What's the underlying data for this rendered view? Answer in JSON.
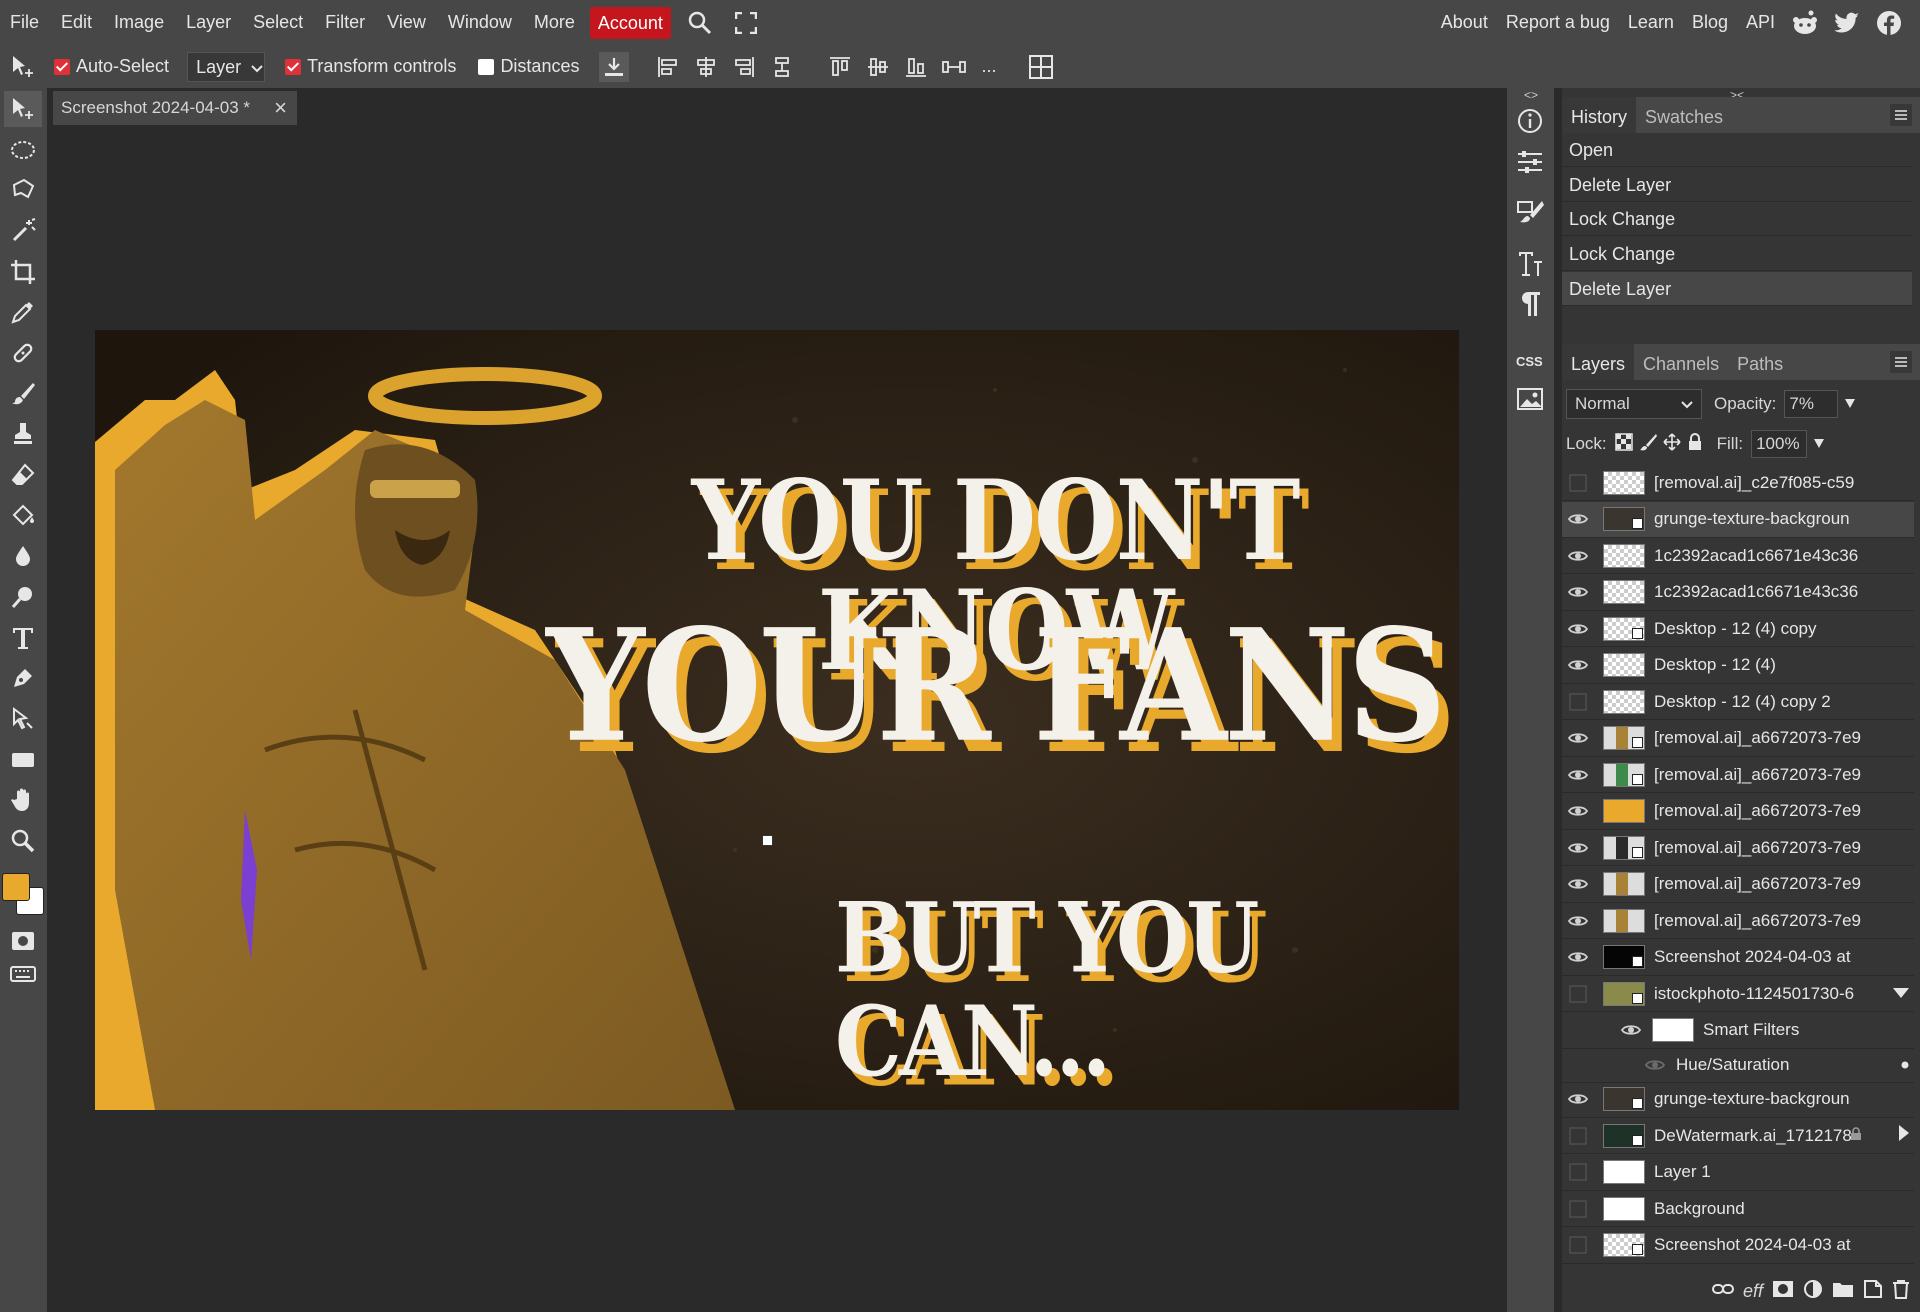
{
  "menu": {
    "items": [
      "File",
      "Edit",
      "Image",
      "Layer",
      "Select",
      "Filter",
      "View",
      "Window",
      "More"
    ],
    "account": "Account",
    "right_items": [
      "About",
      "Report a bug",
      "Learn",
      "Blog",
      "API"
    ]
  },
  "options": {
    "auto_select": "Auto-Select",
    "auto_select_checked": true,
    "layer_select": "Layer",
    "transform_controls": "Transform controls",
    "transform_checked": true,
    "distances": "Distances",
    "distances_checked": false,
    "more": "..."
  },
  "document": {
    "tab_title": "Screenshot 2024-04-03 *",
    "close": "×"
  },
  "artwork": {
    "line1": "YOU DON'T KNOW",
    "line2": "YOUR FANS",
    "line3": "BUT YOU CAN..."
  },
  "colors": {
    "foreground": "#e8a92c",
    "background": "#ffffff",
    "accent_red": "#c4161c",
    "panel": "#353535",
    "toolbar": "#474747"
  },
  "history": {
    "tabs": [
      "History",
      "Swatches"
    ],
    "active_tab": "History",
    "items": [
      "Open",
      "Delete Layer",
      "Lock Change",
      "Lock Change",
      "Delete Layer"
    ]
  },
  "layers": {
    "tabs": [
      "Layers",
      "Channels",
      "Paths"
    ],
    "active_tab": "Layers",
    "blend_mode": "Normal",
    "opacity_label": "Opacity:",
    "opacity_value": "7%",
    "lock_label": "Lock:",
    "fill_label": "Fill:",
    "fill_value": "100%",
    "rows": [
      {
        "name": "[removal.ai]_c2e7f085-c59",
        "visible": false,
        "thumb": "checker",
        "smart": false
      },
      {
        "name": "grunge-texture-backgroun",
        "visible": true,
        "thumb": "dark",
        "smart": true,
        "active": true
      },
      {
        "name": "1c2392acad1c6671e43c36",
        "visible": true,
        "thumb": "checker",
        "smart": false
      },
      {
        "name": "1c2392acad1c6671e43c36",
        "visible": true,
        "thumb": "checker",
        "smart": false
      },
      {
        "name": "Desktop - 12 (4) copy",
        "visible": true,
        "thumb": "checker",
        "smart": true
      },
      {
        "name": "Desktop - 12 (4)",
        "visible": true,
        "thumb": "checker",
        "smart": false
      },
      {
        "name": "Desktop - 12 (4) copy 2",
        "visible": false,
        "thumb": "checker",
        "smart": false
      },
      {
        "name": "[removal.ai]_a6672073-7e9",
        "visible": true,
        "thumb": "figure-gold",
        "smart": true
      },
      {
        "name": "[removal.ai]_a6672073-7e9",
        "visible": true,
        "thumb": "figure-green",
        "smart": true
      },
      {
        "name": "[removal.ai]_a6672073-7e9",
        "visible": true,
        "thumb": "gold",
        "smart": false
      },
      {
        "name": "[removal.ai]_a6672073-7e9",
        "visible": true,
        "thumb": "figure-dark",
        "smart": true
      },
      {
        "name": "[removal.ai]_a6672073-7e9",
        "visible": true,
        "thumb": "figure-gold",
        "smart": false
      },
      {
        "name": "[removal.ai]_a6672073-7e9",
        "visible": true,
        "thumb": "figure-gold",
        "smart": false
      },
      {
        "name": "Screenshot 2024-04-03 at",
        "visible": true,
        "thumb": "black",
        "smart": true
      },
      {
        "name": "istockphoto-1124501730-6",
        "visible": false,
        "thumb": "olive",
        "smart": true
      }
    ],
    "smart_filters": "Smart Filters",
    "hue_saturation": "Hue/Saturation",
    "rows_after": [
      {
        "name": "grunge-texture-backgroun",
        "visible": true,
        "thumb": "dark",
        "smart": true
      },
      {
        "name": "DeWatermark.ai_1712178",
        "visible": false,
        "thumb": "darkgreen",
        "smart": true
      },
      {
        "name": "Layer 1",
        "visible": false,
        "thumb": "white",
        "smart": false
      },
      {
        "name": "Background",
        "visible": false,
        "thumb": "white",
        "smart": false
      },
      {
        "name": "Screenshot 2024-04-03 at",
        "visible": false,
        "thumb": "checker",
        "smart": true
      }
    ],
    "footer_eff": "eff"
  }
}
